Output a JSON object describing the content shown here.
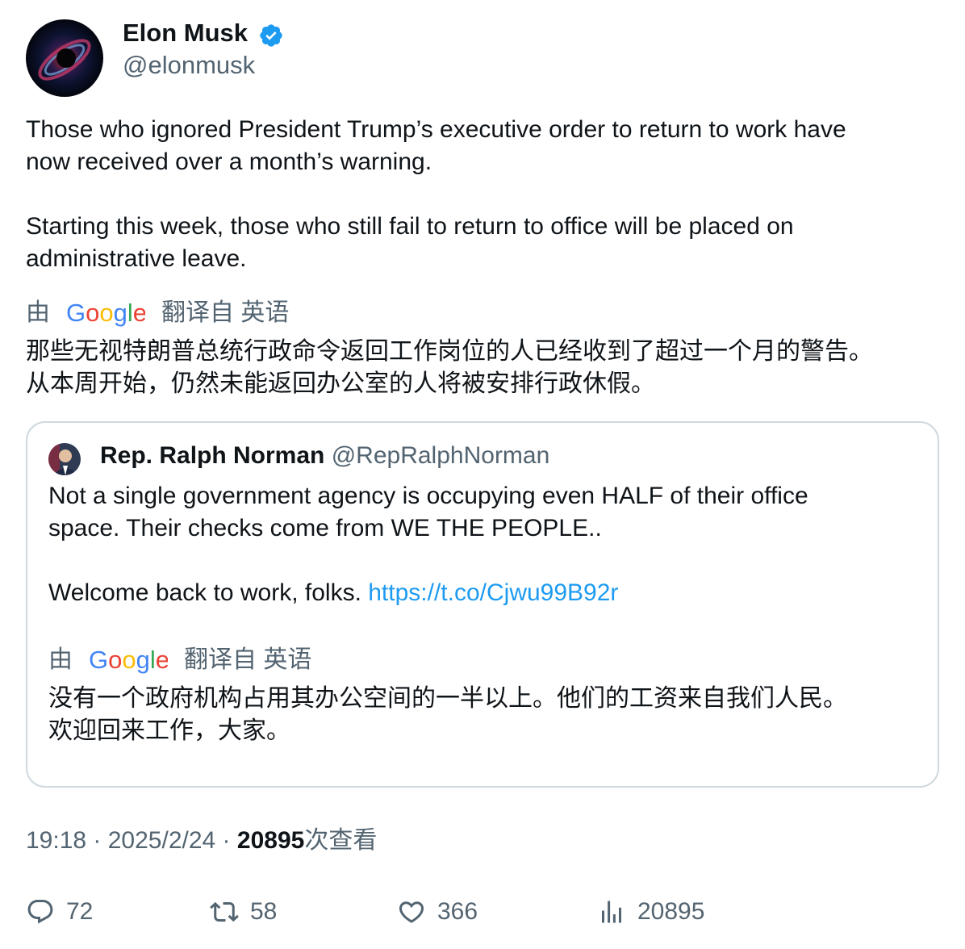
{
  "author": {
    "display_name": "Elon Musk",
    "handle": "@elonmusk",
    "verified_icon": "verified-badge-icon"
  },
  "tweet": {
    "text": "Those who ignored President Trump’s executive order to return to work have\nnow received over a month’s warning.\n\nStarting this week, those who still fail to return to office will be placed on\nadministrative leave.",
    "translate_by": "由",
    "translate_from": "翻译自 英语",
    "translation": "那些无视特朗普总统行政命令返回工作岗位的人已经收到了超过一个月的警告。\n从本周开始，仍然未能返回办公室的人将被安排行政休假。"
  },
  "quote": {
    "display_name": "Rep. Ralph Norman",
    "handle": "@RepRalphNorman",
    "text": "Not a single government agency is occupying even HALF of their office\nspace. Their checks come from WE THE PEOPLE..\n\nWelcome back to work, folks. ",
    "link": "https://t.co/Cjwu99B92r",
    "translate_by": "由",
    "translate_from": "翻译自 英语",
    "translation": "没有一个政府机构占用其办公空间的一半以上。他们的工资来自我们人民。\n欢迎回来工作，大家。"
  },
  "meta": {
    "time": "19:18",
    "sep1": " · ",
    "date": "2025/2/24",
    "sep2": " · ",
    "views_count": "20895",
    "views_label": "次查看"
  },
  "actions": {
    "replies": "72",
    "retweets": "58",
    "likes": "366",
    "views": "20895"
  },
  "colors": {
    "text": "#0f1419",
    "secondary": "#536471",
    "link": "#1d9bf0",
    "verified": "#1d9bf0",
    "border": "#cfd9de"
  }
}
